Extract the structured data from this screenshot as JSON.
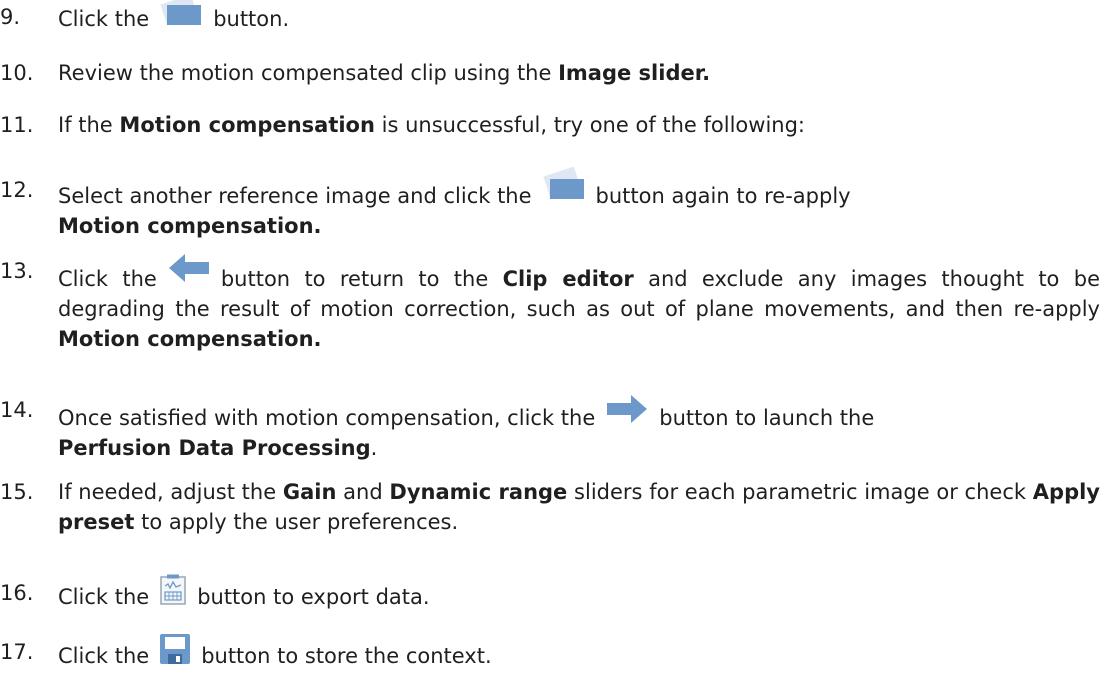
{
  "steps": [
    {
      "num": "9.",
      "a": "Click the",
      "b": "button."
    },
    {
      "num": "10.",
      "a": "Review the motion compensated clip using the",
      "b": "Image slider."
    },
    {
      "num": "11.",
      "a": "If the",
      "b": "Motion compensation",
      "c": "is unsuccessful, try one of the following:"
    },
    {
      "num": "12.",
      "a": "Select another reference image and click the",
      "b": "button again to re-apply",
      "c": "Motion compensation."
    },
    {
      "num": "13.",
      "a": "Click the",
      "b": "button to return to the",
      "c": "Clip editor",
      "d": "and exclude any images thought to be degrading the result of motion correction, such as out of plane movements, and then re-apply",
      "e": "Motion compensation."
    },
    {
      "num": "14.",
      "a": "Once satisfied with motion compensation, click the",
      "b": "button to launch the",
      "c": "Perfusion Data Processing",
      "d": "."
    },
    {
      "num": "15.",
      "a": "If needed, adjust the",
      "b": "Gain",
      "c": "and",
      "d": "Dynamic range",
      "e": "sliders for each parametric image or check",
      "f": "Apply preset",
      "g": "to apply the user preferences."
    },
    {
      "num": "16.",
      "a": "Click the",
      "b": "button to export data."
    },
    {
      "num": "17.",
      "a": "Click the",
      "b": "button to store the context."
    }
  ],
  "icons": {
    "step9": "motion-compensation-icon",
    "step12": "motion-compensation-icon",
    "step13": "back-arrow-icon",
    "step14": "forward-arrow-icon",
    "step16": "export-data-icon",
    "step17": "save-icon"
  }
}
